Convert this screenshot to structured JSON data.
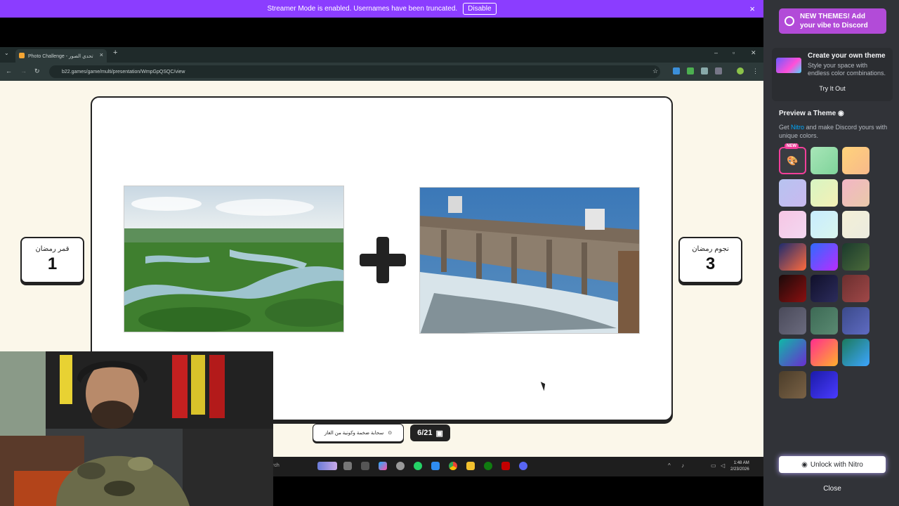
{
  "banner": {
    "text": "Streamer Mode is enabled. Usernames have been truncated.",
    "disable_label": "Disable",
    "close_icon": "×"
  },
  "browser": {
    "tab_title": "Photo Challenge - تحدي الصور",
    "tab_close": "×",
    "new_tab": "+",
    "url": "b22.games/game/multi/presentation/WmpGpQSQC/view",
    "icons": [
      "back-icon",
      "forward-icon",
      "reload-icon",
      "site-info-icon",
      "star-icon"
    ]
  },
  "game": {
    "team_left": {
      "name": "قمر رمضان",
      "score": "1"
    },
    "team_right": {
      "name": "نجوم رمضان",
      "score": "3"
    },
    "hint_text": "سحابة ضخمة وكونية من الغاز",
    "counter": "6/21",
    "images": [
      "river-in-rainforest",
      "hydroelectric-dam"
    ]
  },
  "taskbar": {
    "search": "rch",
    "clock_time": "1:48 AM",
    "clock_date": "2/23/2026",
    "tray_arrow": "^"
  },
  "sidebar": {
    "promo": "NEW THEMES! Add your vibe to Discord",
    "own_title": "Create your own theme",
    "own_desc": "Style your space with endless color combinations.",
    "try_label": "Try It Out",
    "preview_title": "Preview a Theme",
    "preview_desc_pre": "Get ",
    "preview_desc_link": "Nitro",
    "preview_desc_post": " and make Discord yours with unique colors.",
    "new_badge": "NEW",
    "unlock_label": "Unlock with Nitro",
    "close_label": "Close",
    "swatches": [
      "#3a3c42",
      "linear-gradient(135deg,#a8e6b8,#7fd39a)",
      "linear-gradient(135deg,#ffd37a,#f7b98b)",
      "linear-gradient(135deg,#b7c3f0,#c9b9ef)",
      "linear-gradient(135deg,#d7f5c3,#f5f0b5)",
      "linear-gradient(135deg,#f3b6c6,#e9c9a9)",
      "linear-gradient(135deg,#f6c6e4,#f3d7f1)",
      "linear-gradient(135deg,#c8ecff,#d9f6ee)",
      "linear-gradient(135deg,#f4f0d6,#ebebe0)",
      "linear-gradient(135deg,#1d2c6e,#ff6a3d)",
      "linear-gradient(135deg,#2f6bff,#b92cff)",
      "linear-gradient(135deg,#1b3a2c,#4b6b3b)",
      "linear-gradient(135deg,#1a0a0a,#8b1010)",
      "linear-gradient(135deg,#10102a,#2c2c5c)",
      "linear-gradient(135deg,#6b2f2f,#a04848)",
      "linear-gradient(135deg,#4a4a5a,#6b6b7e)",
      "linear-gradient(135deg,#3d6a55,#5a8a72)",
      "linear-gradient(135deg,#3b4a8a,#5f6bc2)",
      "linear-gradient(135deg,#0fb9a6,#6a2dd0)",
      "linear-gradient(135deg,#ff2d8e,#ffb02d)",
      "linear-gradient(135deg,#1b7a5c,#3da5ff)",
      "linear-gradient(135deg,#4b3d2a,#7a6246)",
      "linear-gradient(135deg,#1b1ba8,#4a3bff)"
    ]
  }
}
